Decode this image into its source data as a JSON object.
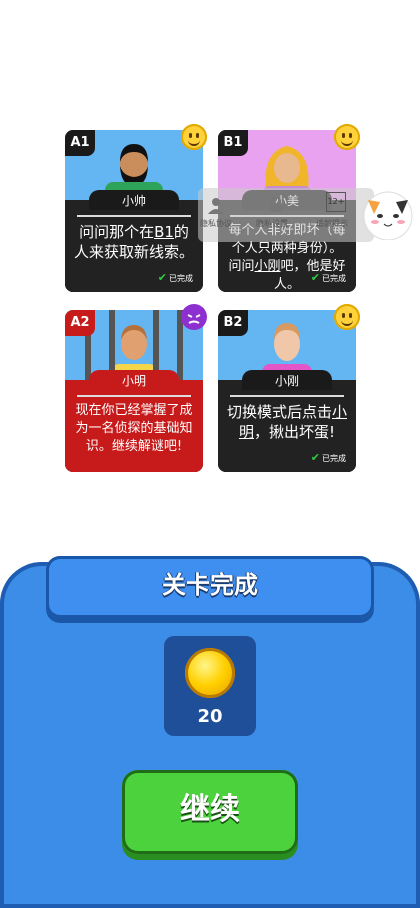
{
  "cards": [
    {
      "tag": "A1",
      "name": "小帅",
      "text_parts": [
        "问问那个在",
        "B1",
        "的人来获取新线索。"
      ],
      "done": "已完成",
      "status_icon": "smile-emoji-icon",
      "bg": "#63b6f2"
    },
    {
      "tag": "B1",
      "name": "小美",
      "text_parts": [
        "每个人非好即坏（每个人只两种身份）。问问",
        "小刚",
        "吧，他是好人。"
      ],
      "done": "已完成",
      "status_icon": "smile-emoji-icon",
      "bg": "#e8a2f0"
    },
    {
      "tag": "A2",
      "name": "小明",
      "text": "现在你已经掌握了成为一名侦探的基础知识。继续解谜吧!",
      "status_icon": "devil-emoji-icon",
      "bg": "#63b6f2"
    },
    {
      "tag": "B2",
      "name": "小刚",
      "text_parts": [
        "切换模式后点击",
        "小明",
        "，揪出坏蛋!"
      ],
      "done": "已完成",
      "status_icon": "smile-emoji-icon",
      "bg": "#63b6f2"
    }
  ],
  "overlay": {
    "items": [
      "隐私协议",
      "隐私设置",
      "适龄提示"
    ],
    "age_badge": "12+"
  },
  "panel": {
    "title": "关卡完成",
    "coins": "20",
    "continue_label": "继续"
  }
}
